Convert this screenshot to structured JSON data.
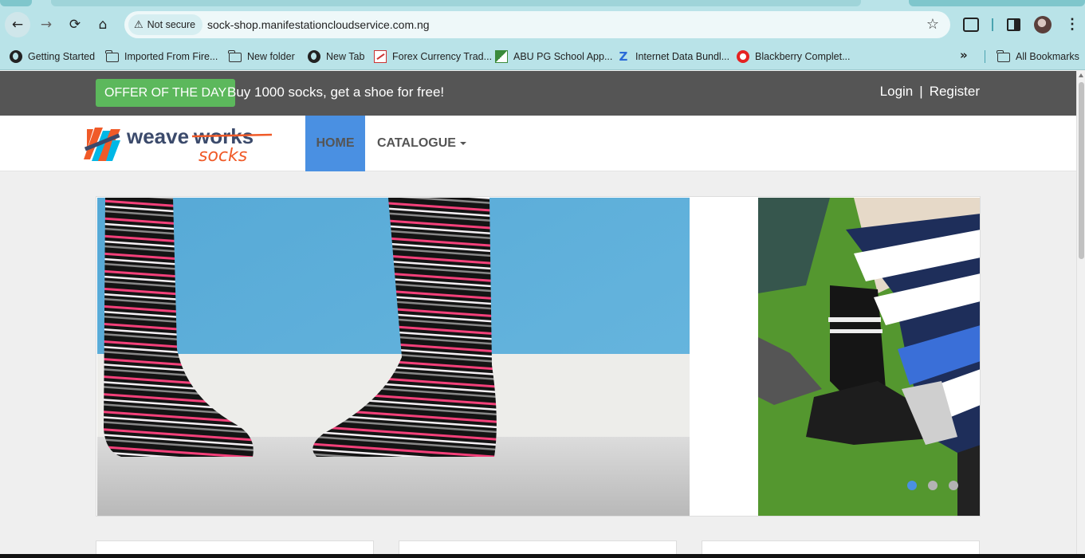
{
  "browser": {
    "security_label": "Not secure",
    "url": "sock-shop.manifestationcloudservice.com.ng",
    "bookmarks": [
      {
        "label": "Getting Started",
        "icon": "globe-icon"
      },
      {
        "label": "Imported From Fire...",
        "icon": "folder-icon"
      },
      {
        "label": "New folder",
        "icon": "folder-icon"
      },
      {
        "label": "New Tab",
        "icon": "globe-icon"
      },
      {
        "label": "Forex Currency Trad...",
        "icon": "forex-icon"
      },
      {
        "label": "ABU PG School App...",
        "icon": "abu-icon"
      },
      {
        "label": "Internet Data Bundl...",
        "icon": "z-icon"
      },
      {
        "label": "Blackberry Complet...",
        "icon": "blackberry-icon"
      }
    ],
    "all_bookmarks": "All Bookmarks",
    "overflow": "»"
  },
  "offer": {
    "badge": "OFFER OF THE DAY",
    "text": "Buy 1000 socks, get a shoe for free!"
  },
  "auth": {
    "login": "Login",
    "separator": "|",
    "register": "Register"
  },
  "nav": {
    "home": "HOME",
    "catalogue": "CATALOGUE"
  },
  "logo": {
    "word1": "weave",
    "word2": "works",
    "word3": "socks"
  },
  "carousel": {
    "slide_count": 3,
    "active_index": 0
  },
  "colors": {
    "offer_bar": "#555555",
    "offer_badge": "#5cb85c",
    "nav_active": "#4a90e2",
    "browser_chrome": "#b9e3e8"
  }
}
